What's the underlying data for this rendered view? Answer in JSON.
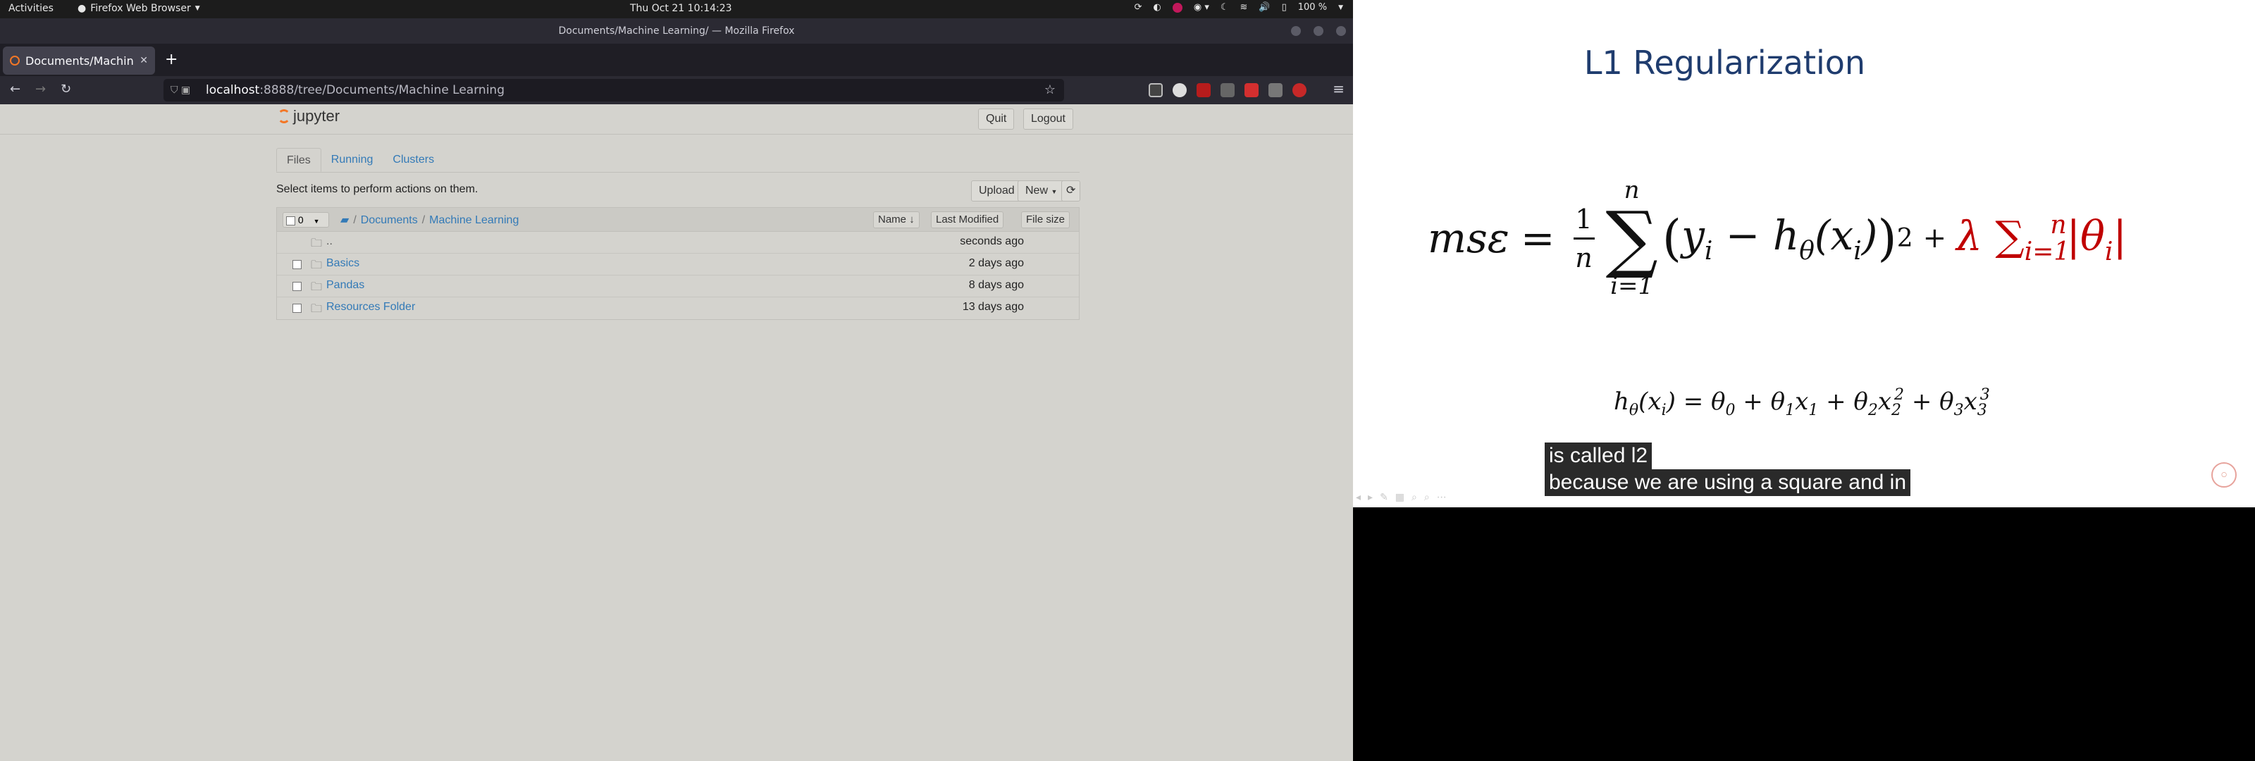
{
  "topbar": {
    "activities": "Activities",
    "app": "Firefox Web Browser",
    "clock": "Thu Oct 21  10:14:23",
    "battery": "100 %"
  },
  "window": {
    "title": "Documents/Machine Learning/ — Mozilla Firefox"
  },
  "tab": {
    "title": "Documents/Machine"
  },
  "url": {
    "host": "localhost",
    "path": ":8888/tree/Documents/Machine Learning"
  },
  "jupyter": {
    "logo": "jupyter",
    "quit": "Quit",
    "logout": "Logout",
    "tabs": [
      "Files",
      "Running",
      "Clusters"
    ],
    "toolbar_text": "Select items to perform actions on them.",
    "upload": "Upload",
    "new": "New",
    "selected_count": "0",
    "breadcrumb": [
      "Documents",
      "Machine Learning"
    ],
    "col_name": "Name",
    "col_modified": "Last Modified",
    "col_size": "File size",
    "rows": [
      {
        "name": "..",
        "modified": "seconds ago"
      },
      {
        "name": "Basics",
        "modified": "2 days ago"
      },
      {
        "name": "Pandas",
        "modified": "8 days ago"
      },
      {
        "name": "Resources Folder",
        "modified": "13 days ago"
      }
    ]
  },
  "slide": {
    "title": "L1 Regularization",
    "caption": [
      "is called l2",
      "because we are using a square and in"
    ],
    "colors": {
      "title": "#1f3c6e",
      "penalty": "#c00000",
      "accent": "#f37726"
    }
  }
}
